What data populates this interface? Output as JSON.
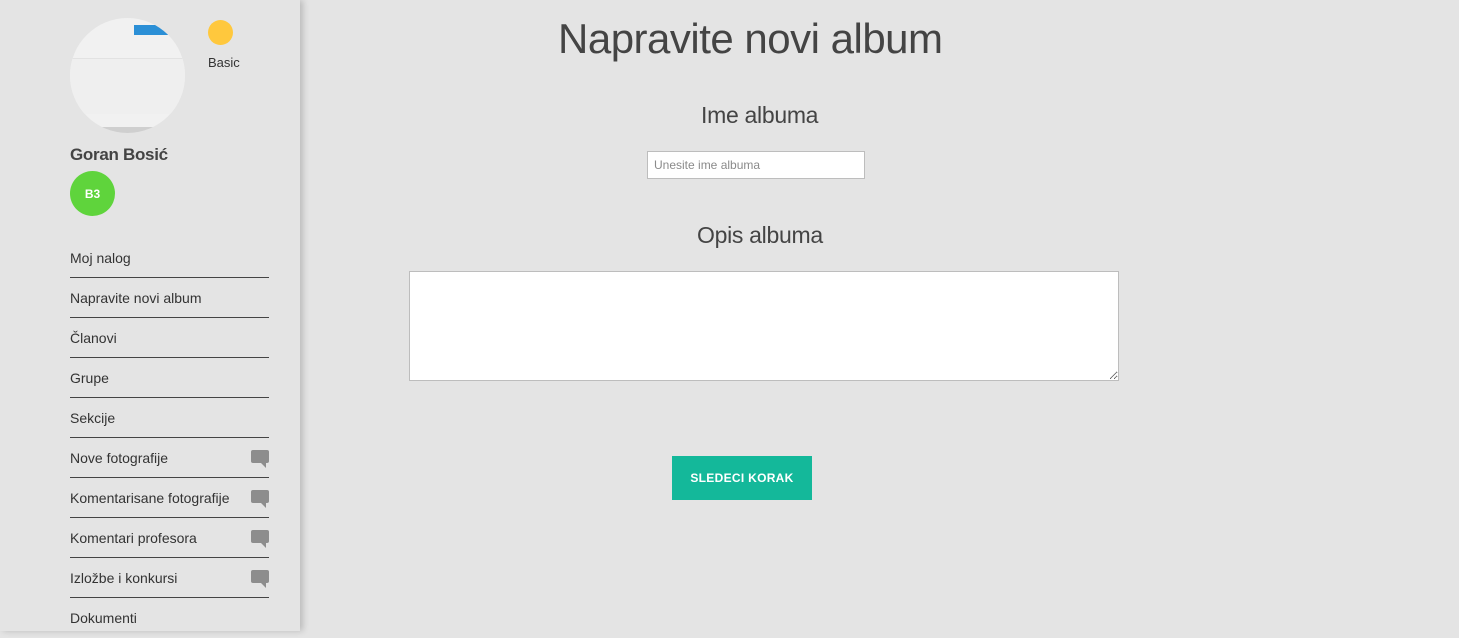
{
  "profile": {
    "name": "Goran Bosić",
    "level": "Basic",
    "class_badge": "B3",
    "colors": {
      "level_dot": "#ffc83d",
      "class_badge": "#5fd43c"
    }
  },
  "sidebar": {
    "items": [
      {
        "label": "Moj nalog",
        "has_chat_icon": false
      },
      {
        "label": "Napravite novi album",
        "has_chat_icon": false
      },
      {
        "label": "Članovi",
        "has_chat_icon": false
      },
      {
        "label": "Grupe",
        "has_chat_icon": false
      },
      {
        "label": "Sekcije",
        "has_chat_icon": false
      },
      {
        "label": "Nove fotografije",
        "has_chat_icon": true
      },
      {
        "label": "Komentarisane fotografije",
        "has_chat_icon": true
      },
      {
        "label": "Komentari profesora",
        "has_chat_icon": true
      },
      {
        "label": "Izložbe i konkursi",
        "has_chat_icon": true
      },
      {
        "label": "Dokumenti",
        "has_chat_icon": false
      }
    ]
  },
  "form": {
    "title": "Napravite novi album",
    "name_label": "Ime albuma",
    "name_placeholder": "Unesite ime albuma",
    "name_value": "",
    "description_label": "Opis albuma",
    "description_value": "",
    "submit_label": "SLEDECI KORAK",
    "colors": {
      "submit_bg": "#14b89a"
    }
  }
}
